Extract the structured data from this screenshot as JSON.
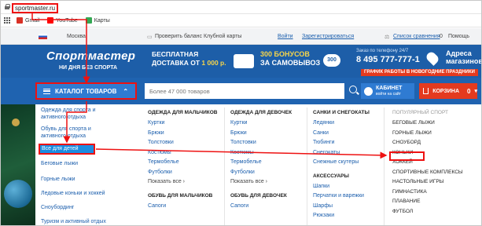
{
  "browser": {
    "url": "sportmaster.ru",
    "bookmarks": [
      {
        "label": "Gmail",
        "icon": "gmail-icon",
        "color": "#d93025"
      },
      {
        "label": "YouTube",
        "icon": "youtube-icon",
        "color": "#ff0000"
      },
      {
        "label": "Карты",
        "icon": "maps-icon",
        "color": "#34a853"
      }
    ]
  },
  "topstrip": {
    "city": "Москва",
    "club_balance": "Проверить баланс Клубной карты",
    "login": "Войти",
    "register": "Зарегистрироваться",
    "compare": "Список сравнения",
    "compare_count": "0",
    "help": "Помощь"
  },
  "header": {
    "logo": "Спортмастер",
    "slogan": "НИ ДНЯ БЕЗ СПОРТА",
    "promo1_line1": "БЕСПЛАТНАЯ",
    "promo1_line2_a": "ДОСТАВКА ОТ",
    "promo1_line2_b": "1 000 р.",
    "promo2_line1_a": "300",
    "promo2_line1_b": "БОНУСОВ",
    "promo2_line2": "ЗА САМОВЫВОЗ",
    "badge": "300",
    "phone_caption": "Заказ по телефону 24/7",
    "phone": "8 495 777-777-1",
    "shops_line1": "Адреса",
    "shops_line2": "магазинов",
    "schedule": "ГРАФИК РАБОТЫ В НОВОГОДНИЕ ПРАЗДНИКИ"
  },
  "nav": {
    "catalog": "КАТАЛОГ ТОВАРОВ",
    "search_placeholder": "Более 47 000 товаров",
    "cabinet_title": "КАБИНЕТ",
    "cabinet_sub": "войти на сайт",
    "cart": "КОРЗИНА",
    "cart_count": "0"
  },
  "sidebar": {
    "items": [
      "Одежда для спорта и",
      "активного отдыха",
      "Обувь для спорта и",
      "активного отдыха",
      "Все для детей",
      "Беговые лыжи",
      "Горные лыжи",
      "Ледовые коньки и хоккей",
      "Сноубординг",
      "Туризм и активный отдых"
    ]
  },
  "columns": [
    {
      "header": "ОДЕЖДА ДЛЯ МАЛЬЧИКОВ",
      "links": [
        "Куртки",
        "Брюки",
        "Толстовки",
        "Костюмы",
        "Термобелье",
        "Футболки"
      ],
      "more": "Показать все ›",
      "header2": "ОБУВЬ ДЛЯ МАЛЬЧИКОВ",
      "links2": [
        "Сапоги"
      ]
    },
    {
      "header": "ОДЕЖДА ДЛЯ ДЕВОЧЕК",
      "links": [
        "Куртки",
        "Брюки",
        "Толстовки",
        "Костюмы",
        "Термобелье",
        "Футболки"
      ],
      "more": "Показать все ›",
      "header2": "ОБУВЬ ДЛЯ ДЕВОЧЕК",
      "links2": [
        "Сапоги"
      ]
    },
    {
      "header": "САНКИ И СНЕГОКАТЫ",
      "links": [
        "Ледянки",
        "Санки",
        "Тюбинги",
        "Снегокаты",
        "Снежные скутеры"
      ],
      "header2": "АКСЕССУАРЫ",
      "links2": [
        "Шапки",
        "Перчатки и варежки",
        "Шарфы",
        "Рюкзаки"
      ]
    },
    {
      "header": "ПОПУЛЯРНЫЙ СПОРТ",
      "links": [
        "БЕГОВЫЕ ЛЫЖИ",
        "ГОРНЫЕ ЛЫЖИ",
        "СНОУБОРД",
        "КОНЬКИ",
        "ХОККЕЙ",
        "СПОРТИВНЫЕ КОМПЛЕКСЫ",
        "НАСТОЛЬНЫЕ ИГРЫ",
        "ГИМНАСТИКА",
        "ПЛАВАНИЕ",
        "ФУТБОЛ"
      ]
    }
  ]
}
